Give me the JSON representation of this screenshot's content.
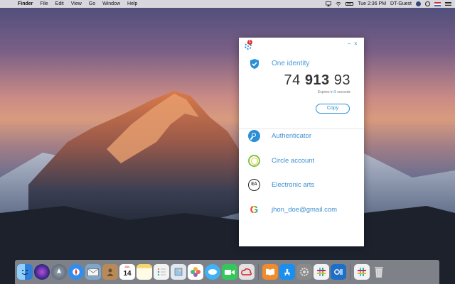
{
  "menubar": {
    "apple_symbol": "",
    "app_name": "Finder",
    "menus": [
      "File",
      "Edit",
      "View",
      "Go",
      "Window",
      "Help"
    ],
    "clock": "Tue 2:36 PM",
    "user_name": "DT-Guest"
  },
  "auth_window": {
    "notification_count": "1",
    "minimize_symbol": "–",
    "close_symbol": "×",
    "identity": {
      "name": "One identity",
      "code_part1": "74",
      "code_part2": "913",
      "code_part3": "93",
      "expires_prefix": "Expires in ",
      "expires_seconds": "5",
      "expires_suffix": " seconds",
      "copy_label": "Copy"
    },
    "accounts": [
      {
        "label": "Authenticator",
        "icon": "key-icon"
      },
      {
        "label": "Circle account",
        "icon": "circle-logo-icon"
      },
      {
        "label": "Electronic arts",
        "icon": "ea-logo-icon"
      },
      {
        "label": "jhon_doe@gmail.com",
        "icon": "google-icon"
      }
    ],
    "ea_text": "EA",
    "google_letter": "G"
  },
  "dock": {
    "calendar_month": "JUL",
    "calendar_day": "14",
    "colors": {
      "finder": "#3b8de0",
      "siri": "#3a2a8f",
      "launchpad": "#5b6b7d",
      "safari": "#2d8ff0",
      "mail": "#7fa7c9",
      "contacts": "#b78a5a",
      "notes": "#f5d76e",
      "reminders": "#f3f3f3",
      "preview": "#e0e8f0",
      "photos": "#ffffff",
      "messages": "#3fb3f4",
      "facetime": "#35c759",
      "creative_cloud": "#e2e2e2",
      "books": "#f08c2c",
      "appstore": "#1a8ff0",
      "sysprefs": "#8a8a8a",
      "slack": "#f2f2f2",
      "outlook": "#1f6fc6",
      "trash": "#d8d8d8"
    }
  }
}
